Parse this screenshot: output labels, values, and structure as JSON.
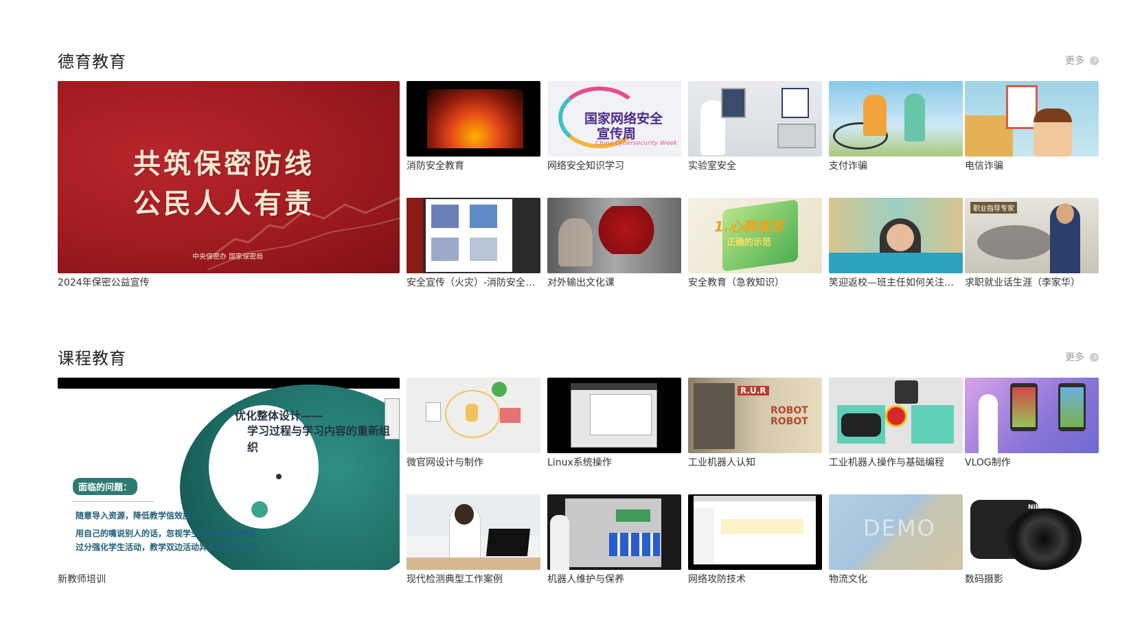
{
  "sections": [
    {
      "title": "德育教育",
      "more_label": "更多",
      "feature": {
        "caption": "2024年保密公益宣传",
        "thumb_text_1": "共筑保密防线",
        "thumb_text_2": "公民人人有责",
        "thumb_small": "中央保密办  国家保密局"
      },
      "cards": [
        {
          "caption": "消防安全教育"
        },
        {
          "caption": "网络安全知识学习",
          "thumb_text_1": "国家网络安全",
          "thumb_text_2": "宣传周",
          "thumb_text_3": "China Cybersecurity Week"
        },
        {
          "caption": "实验室安全"
        },
        {
          "caption": "支付诈骗"
        },
        {
          "caption": "电信诈骗"
        },
        {
          "caption": "安全宣传（火灾）-消防安全知识"
        },
        {
          "caption": "对外输出文化课"
        },
        {
          "caption": "安全教育（急救知识）",
          "thumb_text_1": "1.心肺复苏",
          "thumb_text_2": "正确的示范"
        },
        {
          "caption": "笑迎返校—班主任如何关注学生心理"
        },
        {
          "caption": "求职就业话生涯（李家华）",
          "thumb_text_1": "职业指导专家"
        }
      ]
    },
    {
      "title": "课程教育",
      "more_label": "更多",
      "feature": {
        "caption": "新教师培训",
        "thumb_head_1": "优化整体设计——",
        "thumb_head_2": "学习过程与学习内容的重新组织",
        "thumb_pill": "面临的问题：",
        "thumb_line_1": "随意导入资源，降低教学信效度",
        "thumb_line_2": "用自己的嘴说别人的话，忽视学生实际困难的解答",
        "thumb_line_3": "过分强化学生活动，教学双边活动异变为单边活动"
      },
      "cards": [
        {
          "caption": "微官网设计与制作"
        },
        {
          "caption": "Linux系统操作"
        },
        {
          "caption": "工业机器人认知",
          "thumb_text_1": "R.U.R",
          "thumb_text_2": "ROBOT",
          "thumb_text_3": "ROBOT"
        },
        {
          "caption": "工业机器人操作与基础编程"
        },
        {
          "caption": "VLOG制作"
        },
        {
          "caption": "现代检测典型工作案例"
        },
        {
          "caption": "机器人维护与保养"
        },
        {
          "caption": "网络攻防技术"
        },
        {
          "caption": "物流文化",
          "thumb_text_1": "DEMO"
        },
        {
          "caption": "数码摄影",
          "thumb_text_1": "Nikon"
        }
      ]
    }
  ]
}
